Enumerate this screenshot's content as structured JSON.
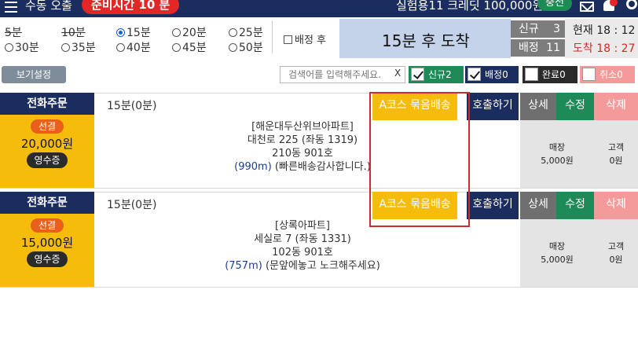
{
  "topbar": {
    "title": "수동 오출",
    "prep_badge": "준비시간 10 분",
    "credit": "실험용11 크레딧 100,000원",
    "charge_label": "충전"
  },
  "filters": {
    "radios": [
      {
        "label": "5분",
        "struck": true
      },
      {
        "label": "10분",
        "struck": true
      },
      {
        "label": "15분",
        "selected": true
      },
      {
        "label": "20분"
      },
      {
        "label": "25분"
      },
      {
        "label": "30분"
      },
      {
        "label": "35분"
      },
      {
        "label": "40분"
      },
      {
        "label": "45분"
      },
      {
        "label": "50분"
      }
    ],
    "after_assign_label": "배정 후"
  },
  "arrival": "15분 후 도착",
  "counts": {
    "new_label": "신규",
    "new_value": "3",
    "assigned_label": "배정",
    "assigned_value": "11"
  },
  "times": {
    "current": "현재 18 : 12",
    "arrival": "도착 18 : 27",
    "current_color": "#111111",
    "arrival_color": "#d12a2a"
  },
  "controls": {
    "view_settings": "보기설정",
    "search_placeholder": "검색어를 입력해주세요.",
    "search_clear": "X",
    "new_filter": "신규2",
    "assigned_filter": "배정0",
    "done_filter": "완료0",
    "cancel_filter": "취소0"
  },
  "colors": {
    "navy": "#1b2d5e",
    "yellow": "#f5bc0b",
    "green": "#1e8a57",
    "pink": "#f59a9a",
    "red": "#d12a2a"
  },
  "orders": [
    {
      "type": "전화주문",
      "wait": "15분(0분)",
      "bundle": "A코스 묶음배송",
      "call": "호출하기",
      "detail": "상세",
      "edit": "수정",
      "delete": "삭제",
      "paid_badge": "선결",
      "amount": "20,000원",
      "receipt": "영수증",
      "address": [
        "[해운대두산위브아파트]",
        "대천로 225 (좌동 1319)",
        "210동 901호"
      ],
      "distance": "(990m)",
      "request": "(빠른배송감사합니다.)",
      "store_fee_label": "매장",
      "store_fee": "5,000원",
      "customer_fee_label": "고객",
      "customer_fee": "0원"
    },
    {
      "type": "전화주문",
      "wait": "15분(0분)",
      "bundle": "A코스 묶음배송",
      "call": "호출하기",
      "detail": "상세",
      "edit": "수정",
      "delete": "삭제",
      "paid_badge": "선결",
      "amount": "15,000원",
      "receipt": "영수증",
      "address": [
        "[상록아파트]",
        "세실로 7 (좌동 1331)",
        "102동 901호"
      ],
      "distance": "(757m)",
      "request": "(문앞에놓고 노크해주세요)",
      "store_fee_label": "매장",
      "store_fee": "5,000원",
      "customer_fee_label": "고객",
      "customer_fee": "0원"
    }
  ]
}
